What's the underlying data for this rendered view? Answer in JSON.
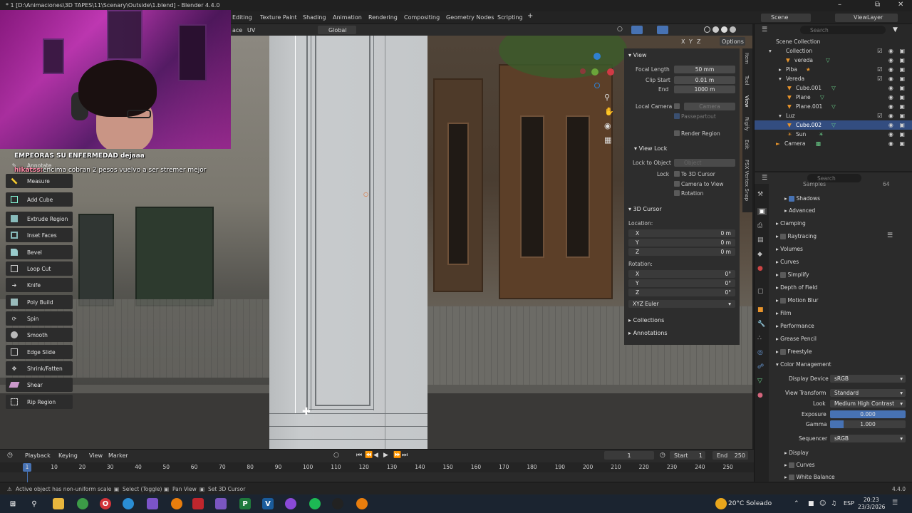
{
  "window": {
    "title": "* 1 [D:\\Animaciones\\3D TAPES\\11\\Scenary\\Outside\\1.blend] - Blender 4.4.0"
  },
  "menubar": {
    "tabs": [
      "Editing",
      "Texture Paint",
      "Shading",
      "Animation",
      "Rendering",
      "Compositing",
      "Geometry Nodes",
      "Scripting"
    ],
    "add_tab": "+",
    "scene": "Scene",
    "view_layer": "ViewLayer"
  },
  "viewport_header": {
    "items": [
      "ace",
      "UV"
    ],
    "orientation": "Global",
    "xyz": [
      "X",
      "Y",
      "Z"
    ],
    "options": "Options"
  },
  "toolbar": {
    "tools": [
      "Annotate",
      "Measure",
      "Add Cube",
      "Extrude Region",
      "Inset Faces",
      "Bevel",
      "Loop Cut",
      "Knife",
      "Poly Build",
      "Spin",
      "Smooth",
      "Edge Slide",
      "Shrink/Fatten",
      "Shear",
      "Rip Region"
    ]
  },
  "chat": {
    "line1": "EMPEORAS SU ENFERMEDAD dejaaa",
    "line2_user": "hikatss:",
    "line2_msg": "encima cobran 2 pesos vuelvo a ser stremer mejor"
  },
  "npanel": {
    "view_header": "View",
    "focal_length_label": "Focal Length",
    "focal_length": "50 mm",
    "clip_start_label": "Clip Start",
    "clip_start": "0.01 m",
    "end_label": "End",
    "end": "1000 m",
    "local_camera_label": "Local Camera",
    "local_camera": "Camera",
    "passepartout": "Passepartout",
    "render_region": "Render Region",
    "view_lock_header": "View Lock",
    "lock_to_object_label": "Lock to Object",
    "lock_to_object_placeholder": "Object",
    "lock_label": "Lock",
    "to_3d_cursor": "To 3D Cursor",
    "camera_to_view": "Camera to View",
    "rotation_check": "Rotation",
    "cursor_header": "3D Cursor",
    "location_label": "Location:",
    "loc": [
      {
        "axis": "X",
        "value": "0 m"
      },
      {
        "axis": "Y",
        "value": "0 m"
      },
      {
        "axis": "Z",
        "value": "0 m"
      }
    ],
    "rotation_label": "Rotation:",
    "rot": [
      {
        "axis": "X",
        "value": "0°"
      },
      {
        "axis": "Y",
        "value": "0°"
      },
      {
        "axis": "Z",
        "value": "0°"
      }
    ],
    "euler": "XYZ Euler",
    "collections": "Collections",
    "annotations": "Annotations",
    "tabs": [
      "Item",
      "Tool",
      "View",
      "Rigify",
      "Edit",
      "PSX Vertex Snap"
    ]
  },
  "outliner": {
    "search_placeholder": "Search",
    "rows": [
      {
        "label": "Scene Collection",
        "indent": 0,
        "selected": false
      },
      {
        "label": "Collection",
        "indent": 1,
        "selected": false
      },
      {
        "label": "vereda",
        "indent": 2,
        "selected": false
      },
      {
        "label": "Piba",
        "indent": 1,
        "selected": false
      },
      {
        "label": "Vereda",
        "indent": 1,
        "selected": false
      },
      {
        "label": "Cube.001",
        "indent": 2,
        "selected": false
      },
      {
        "label": "Plane",
        "indent": 2,
        "selected": false
      },
      {
        "label": "Plane.001",
        "indent": 2,
        "selected": false
      },
      {
        "label": "Luz",
        "indent": 1,
        "selected": false
      },
      {
        "label": "Cube.002",
        "indent": 2,
        "selected": true
      },
      {
        "label": "Sun",
        "indent": 2,
        "selected": false
      },
      {
        "label": "Camera",
        "indent": 1,
        "selected": false
      }
    ]
  },
  "properties": {
    "search_placeholder": "Search",
    "samples": "Samples",
    "samples_value": "64",
    "shadows": "Shadows",
    "advanced": "Advanced",
    "panels": [
      "Clamping",
      "Raytracing",
      "Volumes",
      "Curves",
      "Simplify",
      "Depth of Field",
      "Motion Blur",
      "Film",
      "Performance",
      "Grease Pencil",
      "Freestyle",
      "Color Management"
    ],
    "display_device_label": "Display Device",
    "display_device": "sRGB",
    "view_transform_label": "View Transform",
    "view_transform": "Standard",
    "look_label": "Look",
    "look": "Medium High Contrast",
    "exposure_label": "Exposure",
    "exposure": "0.000",
    "gamma_label": "Gamma",
    "gamma": "1.000",
    "sequencer_label": "Sequencer",
    "sequencer": "sRGB",
    "sub": [
      "Display",
      "Curves",
      "White Balance"
    ]
  },
  "timeline": {
    "menus": [
      "Playback",
      "Keying",
      "View",
      "Marker"
    ],
    "current_frame": "1",
    "start_label": "Start",
    "start": "1",
    "end_label": "End",
    "end": "250",
    "marker": "1",
    "ticks": [
      "10",
      "20",
      "30",
      "40",
      "50",
      "60",
      "70",
      "80",
      "90",
      "100",
      "110",
      "120",
      "130",
      "140",
      "150",
      "160",
      "170",
      "180",
      "190",
      "200",
      "210",
      "220",
      "230",
      "240",
      "250"
    ]
  },
  "statusbar": {
    "msg": "Active object has non-uniform scale",
    "select": "Select (Toggle)",
    "pan": "Pan View",
    "cursor": "Set 3D Cursor",
    "version": "4.4.0"
  },
  "taskbar": {
    "weather": "20°C  Soleado",
    "lang": "ESP",
    "time": "20:23",
    "date": "23/3/2026"
  }
}
